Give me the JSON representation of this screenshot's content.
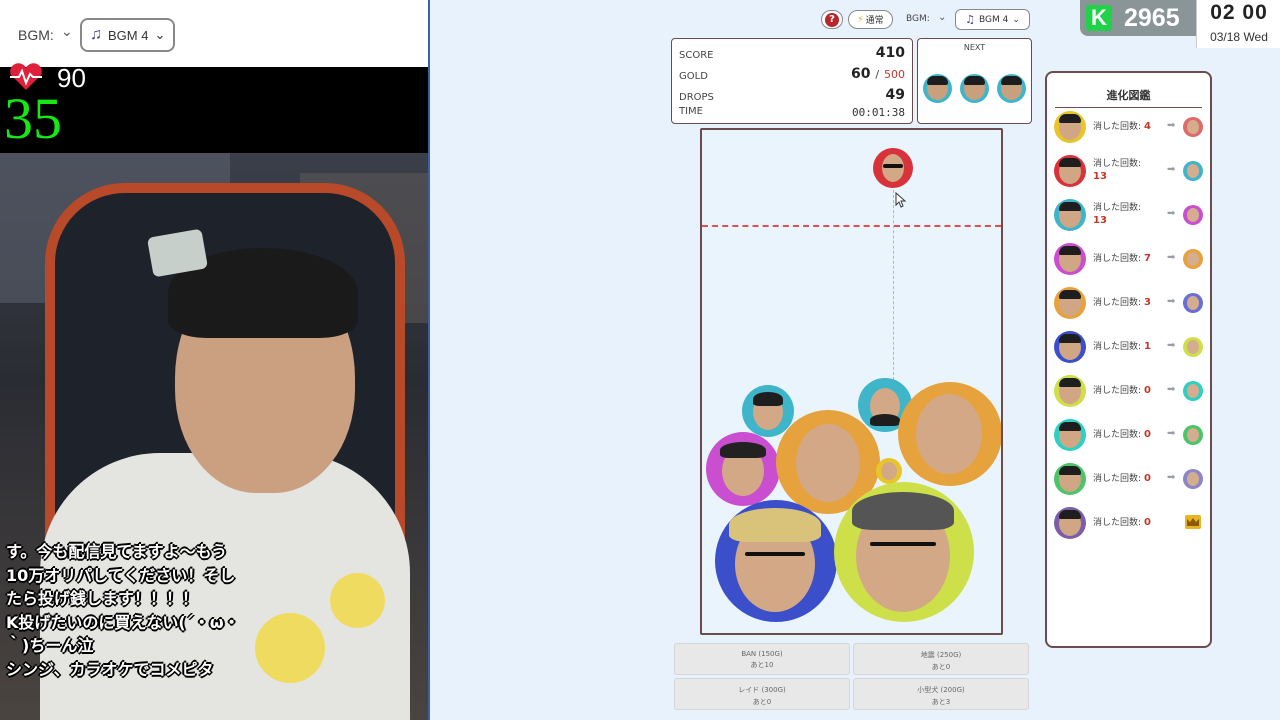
{
  "stream": {
    "bgm_label": "BGM:",
    "bgm_value": "BGM 4",
    "heart_value": "90",
    "counter_value": "35",
    "chat_lines": [
      "す。今も配信見てますよ～もう",
      "10万オリパしてください！そし",
      "たら投げ銭します！！！！",
      "K投げたいのに買えない(´・ω・",
      "｀)ちーん泣",
      "シンジ、カラオケでコメピタ"
    ]
  },
  "topbar": {
    "help_label": "?",
    "speed_label": "通常",
    "bgm_label": "BGM:",
    "bgm_value": "BGM 4"
  },
  "overlay": {
    "k_logo": "K",
    "k_amount": "2965",
    "clock_time": "02 00",
    "clock_date": "03/18 Wed"
  },
  "score": {
    "score_label": "SCORE",
    "score_value": "410",
    "gold_label": "GOLD",
    "gold_value": "60",
    "gold_sep": "/",
    "gold_max": "500",
    "drops_label": "DROPS",
    "drops_value": "49",
    "time_label": "TIME",
    "time_value": "00:01:38"
  },
  "next": {
    "label": "NEXT"
  },
  "items": [
    {
      "name": "BAN (150G)",
      "sub": "あと10"
    },
    {
      "name": "地震 (250G)",
      "sub": "あと0"
    },
    {
      "name": "レイド (300G)",
      "sub": "あと0"
    },
    {
      "name": "小型犬 (200G)",
      "sub": "あと3"
    }
  ],
  "evolution": {
    "title": "進化図鑑",
    "rows": [
      {
        "label": "消した回数:",
        "count": "4",
        "color": "#e8c62a",
        "next_color": "#e06a6a"
      },
      {
        "label": "消した回数:",
        "count": "13",
        "color": "#d8323a",
        "next_color": "#3fb5c9"
      },
      {
        "label": "消した回数:",
        "count": "13",
        "color": "#3fb5c9",
        "next_color": "#c94fd0"
      },
      {
        "label": "消した回数:",
        "count": "7",
        "color": "#c94fd0",
        "next_color": "#e6a23c"
      },
      {
        "label": "消した回数:",
        "count": "3",
        "color": "#e6a23c",
        "next_color": "#6a6fd6"
      },
      {
        "label": "消した回数:",
        "count": "1",
        "color": "#3a4fc9",
        "next_color": "#cde04a"
      },
      {
        "label": "消した回数:",
        "count": "0",
        "color": "#cde04a",
        "next_color": "#2fcfc2"
      },
      {
        "label": "消した回数:",
        "count": "0",
        "color": "#2fcfc2",
        "next_color": "#4cc46a"
      },
      {
        "label": "消した回数:",
        "count": "0",
        "color": "#4cc46a",
        "next_color": "#8a86c8"
      },
      {
        "label": "消した回数:",
        "count": "0",
        "color": "#7a5fa8",
        "next_color": "#e0b534"
      }
    ]
  },
  "colors": {
    "accent_border": "#6b4b4b",
    "deadline": "#e05050",
    "count_red": "#c0392b",
    "k_green": "#22d14a"
  }
}
